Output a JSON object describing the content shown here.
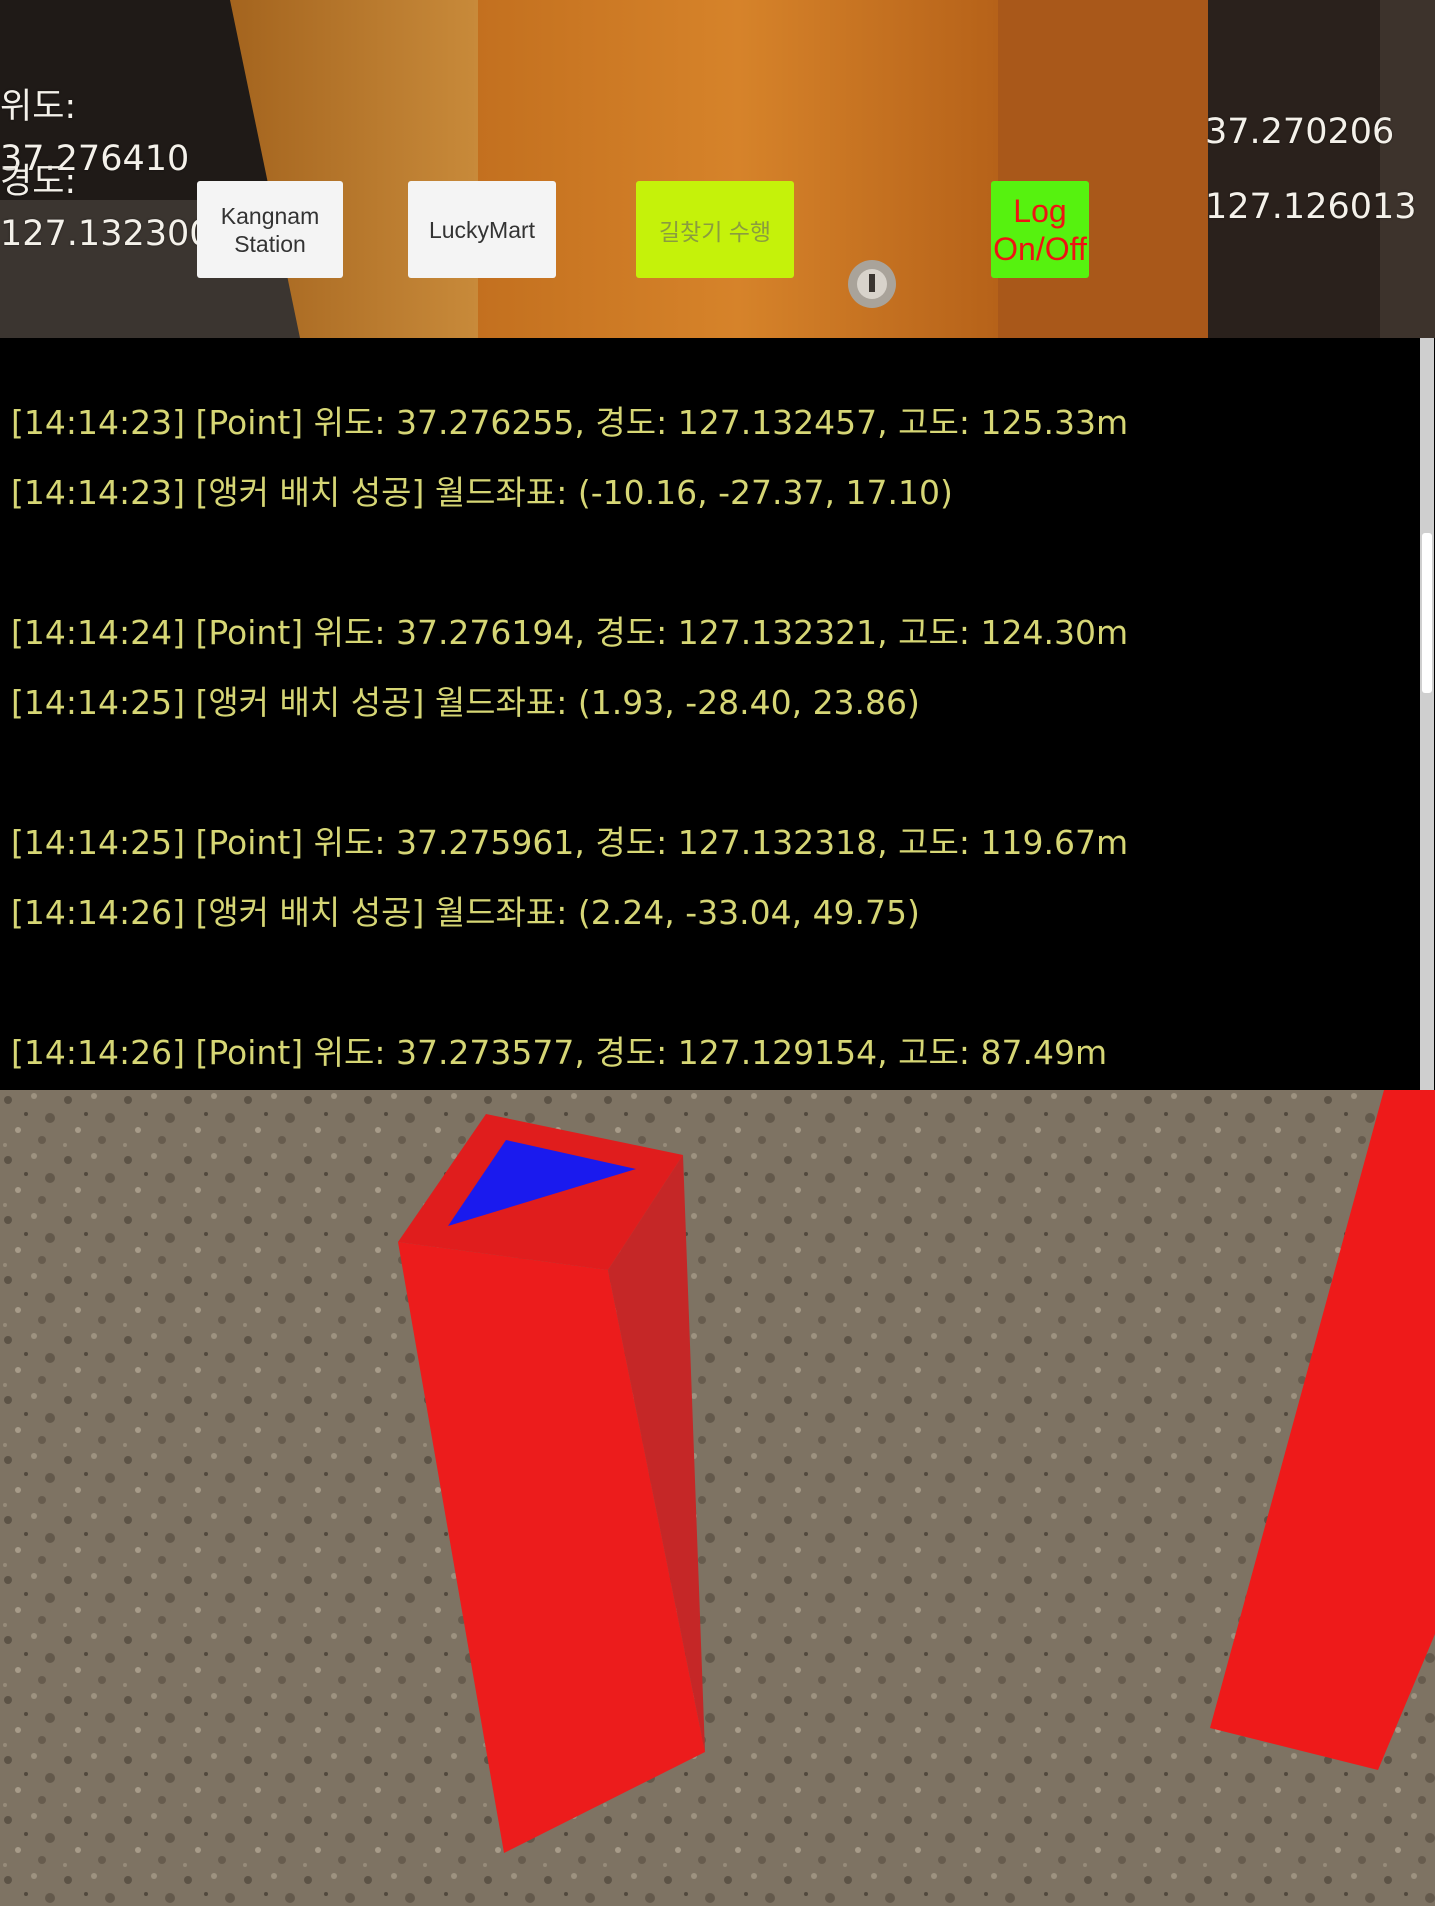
{
  "gps_panel": {
    "lat_label": "위도:",
    "lat_value": "37.276410",
    "lon_label": "경도:",
    "lon_value": "127.132300"
  },
  "target_panel": {
    "lat_value": "37.270206",
    "lon_value": "127.126013"
  },
  "buttons": {
    "kangnam_line1": "Kangnam",
    "kangnam_line2": "Station",
    "luckymart": "LuckyMart",
    "route": "길찾기 수행",
    "log_line1": "Log",
    "log_line2": "On/Off"
  },
  "log": {
    "lines": [
      "[14:14:23] [Point] 위도: 37.276255, 경도: 127.132457, 고도: 125.33m",
      "[14:14:23] [앵커 배치 성공] 월드좌표: (-10.16, -27.37, 17.10)",
      "[14:14:24] [Point] 위도: 37.276194, 경도: 127.132321, 고도: 124.30m",
      "[14:14:25] [앵커 배치 성공] 월드좌표: (1.93, -28.40, 23.86)",
      "[14:14:25] [Point] 위도: 37.275961, 경도: 127.132318, 고도: 119.67m",
      "[14:14:26] [앵커 배치 성공] 월드좌표: (2.24, -33.04, 49.75)",
      "[14:14:26] [Point] 위도: 37.273577, 경도: 127.129154, 고도: 87.49m"
    ]
  },
  "colors": {
    "log_text": "#d6d675",
    "route_button": "#c5f20a",
    "log_button": "#56f20f",
    "marker_red": "#e8181c",
    "marker_top": "#1a1aee"
  }
}
